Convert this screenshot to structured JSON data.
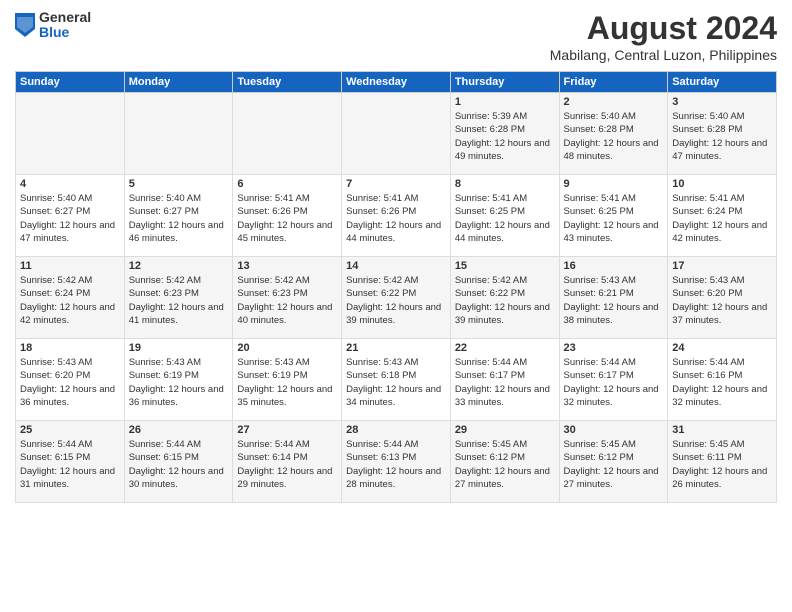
{
  "logo": {
    "general": "General",
    "blue": "Blue"
  },
  "title": "August 2024",
  "subtitle": "Mabilang, Central Luzon, Philippines",
  "headers": [
    "Sunday",
    "Monday",
    "Tuesday",
    "Wednesday",
    "Thursday",
    "Friday",
    "Saturday"
  ],
  "weeks": [
    [
      {
        "day": "",
        "info": ""
      },
      {
        "day": "",
        "info": ""
      },
      {
        "day": "",
        "info": ""
      },
      {
        "day": "",
        "info": ""
      },
      {
        "day": "1",
        "info": "Sunrise: 5:39 AM\nSunset: 6:28 PM\nDaylight: 12 hours and 49 minutes."
      },
      {
        "day": "2",
        "info": "Sunrise: 5:40 AM\nSunset: 6:28 PM\nDaylight: 12 hours and 48 minutes."
      },
      {
        "day": "3",
        "info": "Sunrise: 5:40 AM\nSunset: 6:28 PM\nDaylight: 12 hours and 47 minutes."
      }
    ],
    [
      {
        "day": "4",
        "info": "Sunrise: 5:40 AM\nSunset: 6:27 PM\nDaylight: 12 hours and 47 minutes."
      },
      {
        "day": "5",
        "info": "Sunrise: 5:40 AM\nSunset: 6:27 PM\nDaylight: 12 hours and 46 minutes."
      },
      {
        "day": "6",
        "info": "Sunrise: 5:41 AM\nSunset: 6:26 PM\nDaylight: 12 hours and 45 minutes."
      },
      {
        "day": "7",
        "info": "Sunrise: 5:41 AM\nSunset: 6:26 PM\nDaylight: 12 hours and 44 minutes."
      },
      {
        "day": "8",
        "info": "Sunrise: 5:41 AM\nSunset: 6:25 PM\nDaylight: 12 hours and 44 minutes."
      },
      {
        "day": "9",
        "info": "Sunrise: 5:41 AM\nSunset: 6:25 PM\nDaylight: 12 hours and 43 minutes."
      },
      {
        "day": "10",
        "info": "Sunrise: 5:41 AM\nSunset: 6:24 PM\nDaylight: 12 hours and 42 minutes."
      }
    ],
    [
      {
        "day": "11",
        "info": "Sunrise: 5:42 AM\nSunset: 6:24 PM\nDaylight: 12 hours and 42 minutes."
      },
      {
        "day": "12",
        "info": "Sunrise: 5:42 AM\nSunset: 6:23 PM\nDaylight: 12 hours and 41 minutes."
      },
      {
        "day": "13",
        "info": "Sunrise: 5:42 AM\nSunset: 6:23 PM\nDaylight: 12 hours and 40 minutes."
      },
      {
        "day": "14",
        "info": "Sunrise: 5:42 AM\nSunset: 6:22 PM\nDaylight: 12 hours and 39 minutes."
      },
      {
        "day": "15",
        "info": "Sunrise: 5:42 AM\nSunset: 6:22 PM\nDaylight: 12 hours and 39 minutes."
      },
      {
        "day": "16",
        "info": "Sunrise: 5:43 AM\nSunset: 6:21 PM\nDaylight: 12 hours and 38 minutes."
      },
      {
        "day": "17",
        "info": "Sunrise: 5:43 AM\nSunset: 6:20 PM\nDaylight: 12 hours and 37 minutes."
      }
    ],
    [
      {
        "day": "18",
        "info": "Sunrise: 5:43 AM\nSunset: 6:20 PM\nDaylight: 12 hours and 36 minutes."
      },
      {
        "day": "19",
        "info": "Sunrise: 5:43 AM\nSunset: 6:19 PM\nDaylight: 12 hours and 36 minutes."
      },
      {
        "day": "20",
        "info": "Sunrise: 5:43 AM\nSunset: 6:19 PM\nDaylight: 12 hours and 35 minutes."
      },
      {
        "day": "21",
        "info": "Sunrise: 5:43 AM\nSunset: 6:18 PM\nDaylight: 12 hours and 34 minutes."
      },
      {
        "day": "22",
        "info": "Sunrise: 5:44 AM\nSunset: 6:17 PM\nDaylight: 12 hours and 33 minutes."
      },
      {
        "day": "23",
        "info": "Sunrise: 5:44 AM\nSunset: 6:17 PM\nDaylight: 12 hours and 32 minutes."
      },
      {
        "day": "24",
        "info": "Sunrise: 5:44 AM\nSunset: 6:16 PM\nDaylight: 12 hours and 32 minutes."
      }
    ],
    [
      {
        "day": "25",
        "info": "Sunrise: 5:44 AM\nSunset: 6:15 PM\nDaylight: 12 hours and 31 minutes."
      },
      {
        "day": "26",
        "info": "Sunrise: 5:44 AM\nSunset: 6:15 PM\nDaylight: 12 hours and 30 minutes."
      },
      {
        "day": "27",
        "info": "Sunrise: 5:44 AM\nSunset: 6:14 PM\nDaylight: 12 hours and 29 minutes."
      },
      {
        "day": "28",
        "info": "Sunrise: 5:44 AM\nSunset: 6:13 PM\nDaylight: 12 hours and 28 minutes."
      },
      {
        "day": "29",
        "info": "Sunrise: 5:45 AM\nSunset: 6:12 PM\nDaylight: 12 hours and 27 minutes."
      },
      {
        "day": "30",
        "info": "Sunrise: 5:45 AM\nSunset: 6:12 PM\nDaylight: 12 hours and 27 minutes."
      },
      {
        "day": "31",
        "info": "Sunrise: 5:45 AM\nSunset: 6:11 PM\nDaylight: 12 hours and 26 minutes."
      }
    ]
  ]
}
